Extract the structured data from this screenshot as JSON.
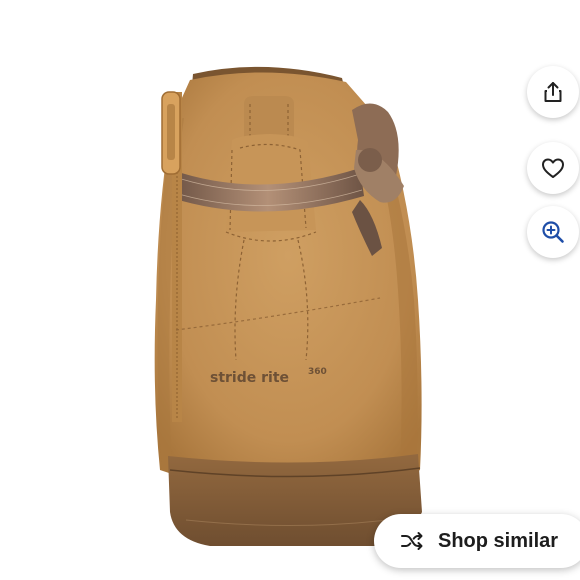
{
  "product_image": {
    "brand_text": "stride rite",
    "brand_suffix": "360",
    "colors": {
      "suede": "#c69558",
      "suede_dark": "#a87639",
      "sole": "#8b6440",
      "glitter": "#8a6a55",
      "background": "#ffffff"
    }
  },
  "actions": {
    "share_icon": "share-icon",
    "like_icon": "heart-icon",
    "zoom_icon": "zoom-in-icon"
  },
  "shop_similar": {
    "label": "Shop similar",
    "icon": "shuffle-icon"
  }
}
